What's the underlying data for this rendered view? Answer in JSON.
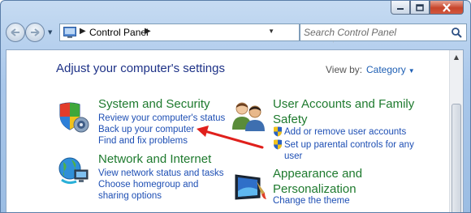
{
  "window": {
    "caption": {
      "minimize_icon": "minimize-icon",
      "maximize_icon": "maximize-icon",
      "close_icon": "close-icon"
    }
  },
  "address_bar": {
    "crumbs": [
      "Control Panel"
    ],
    "location_icon": "control-panel-icon"
  },
  "search": {
    "placeholder": "Search Control Panel",
    "icon": "search-icon"
  },
  "main": {
    "heading": "Adjust your computer's settings",
    "view_by_label": "View by:",
    "view_by_value": "Category",
    "categories": [
      {
        "title": "System and Security",
        "icon": "shield-icon",
        "links": [
          "Review your computer's status",
          "Back up your computer",
          "Find and fix problems"
        ]
      },
      {
        "title": "Network and Internet",
        "icon": "network-globe-icon",
        "links": [
          "View network status and tasks",
          "Choose homegroup and sharing options"
        ]
      },
      {
        "title": "User Accounts and Family Safety",
        "icon": "users-icon",
        "links": [
          "Add or remove user accounts",
          "Set up parental controls for any user"
        ]
      },
      {
        "title": "Appearance and Personalization",
        "icon": "monitor-icon",
        "links": [
          "Change the theme"
        ]
      }
    ]
  },
  "colors": {
    "accent_link": "#1e4fb4",
    "category_title": "#1e7a2e",
    "heading": "#1e3287",
    "annotation_arrow": "#e0201c"
  }
}
